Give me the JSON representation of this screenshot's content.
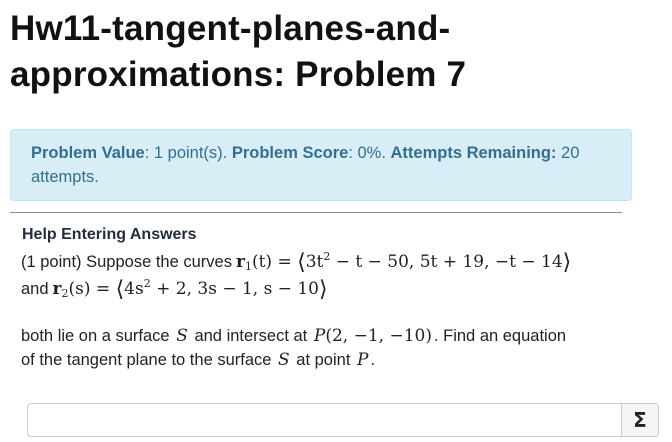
{
  "page": {
    "title": "Hw11-tangent-planes-and-approximations: Problem 7"
  },
  "status": {
    "value_label": "Problem Value",
    "value_text": ": 1 point(s). ",
    "score_label": "Problem Score",
    "score_text": ": 0%. ",
    "attempts_label": "Attempts Remaining:",
    "attempts_text": " 20 attempts."
  },
  "help": {
    "link_label": "Help Entering Answers"
  },
  "problem": {
    "points": "(1 point) Suppose the curves",
    "and": "and",
    "text_both": "both lie on a surface",
    "text_intersect": "and intersect at",
    "text_find": ". Find an equation",
    "text_of": "of the tangent plane to the surface",
    "text_at": "at point",
    "text_end": ".",
    "r1_name": "r",
    "r1_sub": "1",
    "r1_arg": "(t)",
    "r1_comp1": "3t",
    "r1_comp1_exp": "2",
    "r1_comp1_rest": " − t − 50, 5t + 19, −t − 14",
    "r2_name": "r",
    "r2_sub": "2",
    "r2_arg": "(s)",
    "r2_comp1": "4s",
    "r2_comp1_exp": "2",
    "r2_comp1_rest": " + 2, 3s − 1, s − 10",
    "surface": "S",
    "point_name": "P",
    "point_coords": "(2, −1, −10)"
  },
  "answer": {
    "value": "",
    "placeholder": "",
    "sigma_label": "Σ"
  }
}
